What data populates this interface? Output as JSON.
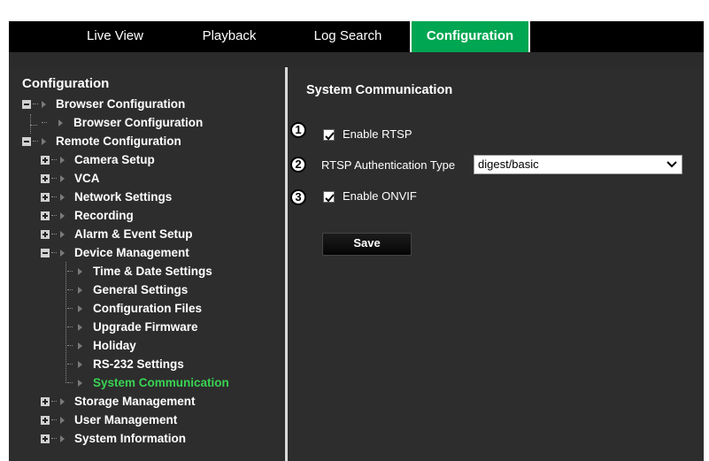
{
  "topnav": {
    "tabs": [
      {
        "label": "Live View"
      },
      {
        "label": "Playback"
      },
      {
        "label": "Log Search"
      },
      {
        "label": "Configuration"
      }
    ],
    "active_tab": "Configuration",
    "active_color": "#00a651"
  },
  "sidebar": {
    "title": "Configuration",
    "items": [
      {
        "label": "Browser Configuration"
      },
      {
        "label": "Browser Configuration"
      },
      {
        "label": "Remote Configuration"
      },
      {
        "label": "Camera Setup"
      },
      {
        "label": "VCA"
      },
      {
        "label": "Network Settings"
      },
      {
        "label": "Recording"
      },
      {
        "label": "Alarm & Event Setup"
      },
      {
        "label": "Device Management"
      },
      {
        "label": "Time & Date Settings"
      },
      {
        "label": "General Settings"
      },
      {
        "label": "Configuration Files"
      },
      {
        "label": "Upgrade Firmware"
      },
      {
        "label": "Holiday"
      },
      {
        "label": "RS-232 Settings"
      },
      {
        "label": "System Communication"
      },
      {
        "label": "Storage Management"
      },
      {
        "label": "User Management"
      },
      {
        "label": "System Information"
      }
    ],
    "selected_item": "System Communication",
    "selected_color": "#39d353"
  },
  "main": {
    "title": "System Communication",
    "callouts": [
      "1",
      "2",
      "3"
    ],
    "enable_rtsp": {
      "label": "Enable RTSP",
      "checked": true
    },
    "rtsp_auth": {
      "label": "RTSP Authentication Type",
      "value": "digest/basic"
    },
    "enable_onvif": {
      "label": "Enable ONVIF",
      "checked": true
    },
    "save_label": "Save"
  }
}
